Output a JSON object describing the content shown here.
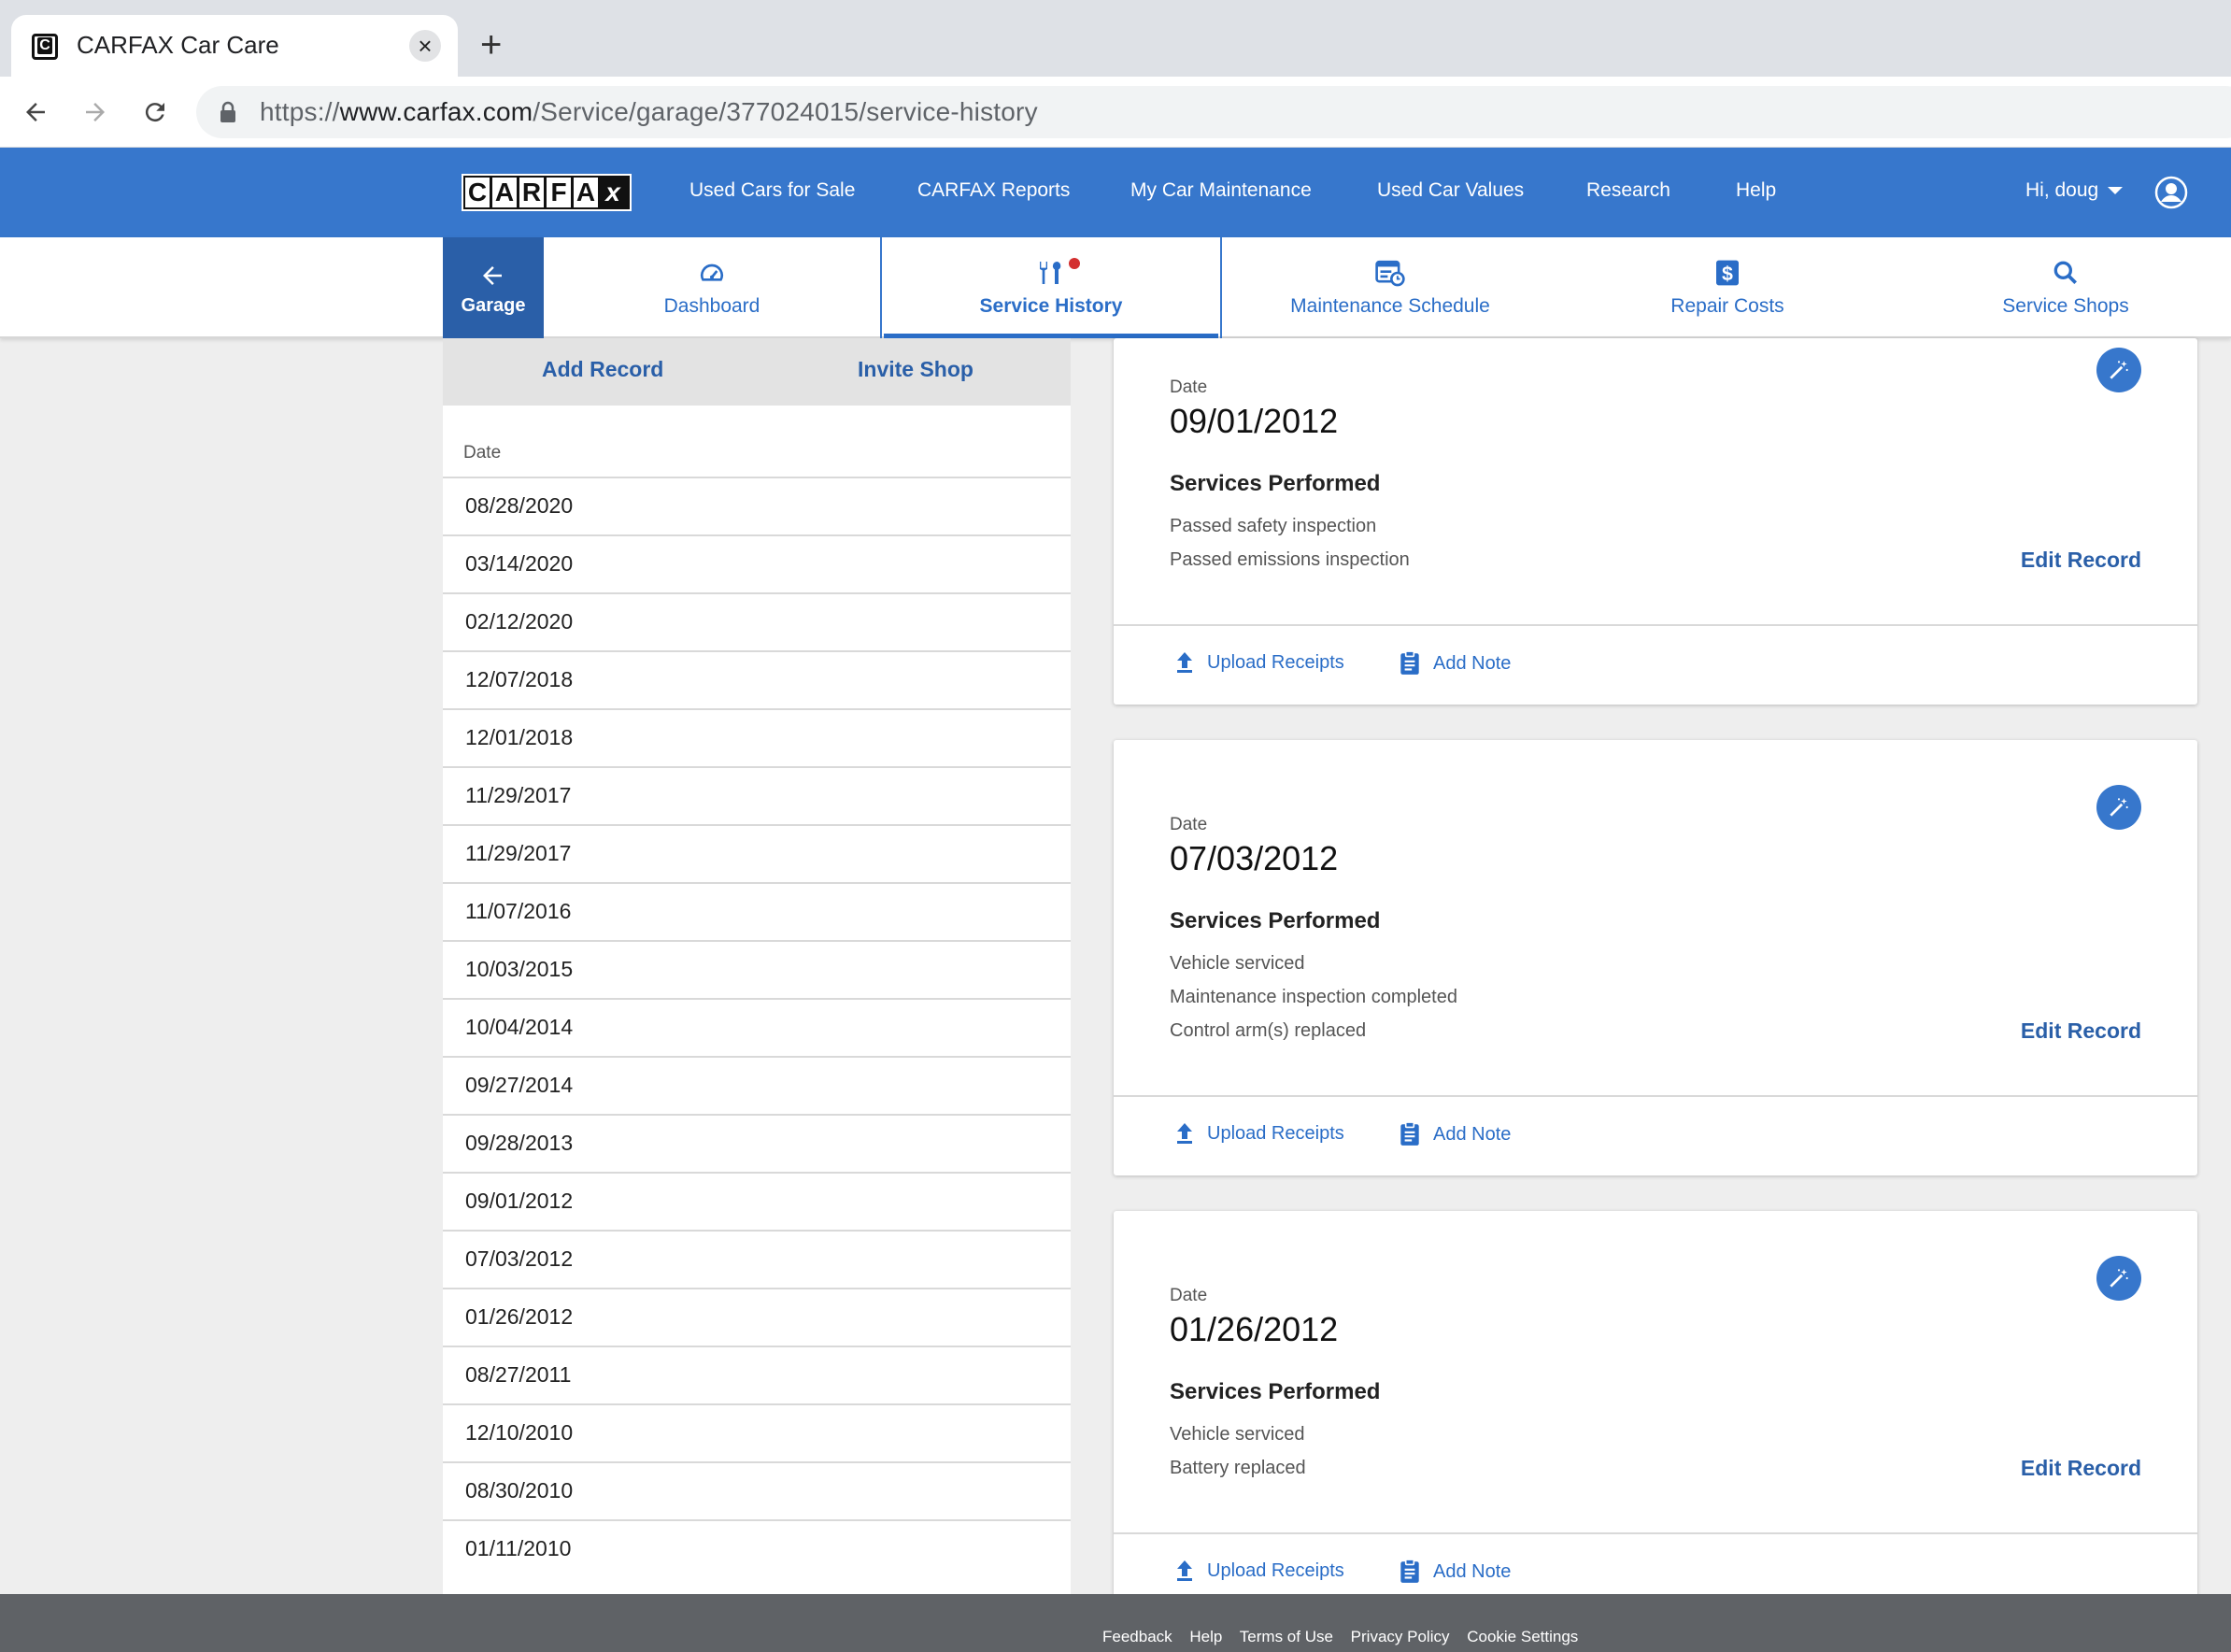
{
  "browser": {
    "tab_title": "CARFAX Car Care",
    "url_scheme": "https://",
    "url_host": "www.carfax.com",
    "url_path": "/Service/garage/377024015/service-history"
  },
  "header": {
    "logo_letters": [
      "C",
      "A",
      "R",
      "F",
      "A",
      "x"
    ],
    "nav": [
      "Used Cars for Sale",
      "CARFAX Reports",
      "My Car Maintenance",
      "Used Car Values",
      "Research",
      "Help"
    ],
    "greeting": "Hi, doug"
  },
  "subnav": {
    "garage": "Garage",
    "tabs": [
      "Dashboard",
      "Service History",
      "Maintenance Schedule",
      "Repair Costs",
      "Service Shops"
    ],
    "active_tab": "Service History"
  },
  "left": {
    "add_record": "Add Record",
    "invite_shop": "Invite Shop",
    "date_header": "Date",
    "dates": [
      "08/28/2020",
      "03/14/2020",
      "02/12/2020",
      "12/07/2018",
      "12/01/2018",
      "11/29/2017",
      "11/29/2017",
      "11/07/2016",
      "10/03/2015",
      "10/04/2014",
      "09/27/2014",
      "09/28/2013",
      "09/01/2012",
      "07/03/2012",
      "01/26/2012",
      "08/27/2011",
      "12/10/2010",
      "08/30/2010",
      "01/11/2010"
    ]
  },
  "records": [
    {
      "date_label": "Date",
      "date": "09/01/2012",
      "services_title": "Services Performed",
      "services": [
        "Passed safety inspection",
        "Passed emissions inspection"
      ],
      "edit": "Edit Record",
      "upload": "Upload Receipts",
      "note": "Add Note"
    },
    {
      "date_label": "Date",
      "date": "07/03/2012",
      "services_title": "Services Performed",
      "services": [
        "Vehicle serviced",
        "Maintenance inspection completed",
        "Control arm(s) replaced"
      ],
      "edit": "Edit Record",
      "upload": "Upload Receipts",
      "note": "Add Note"
    },
    {
      "date_label": "Date",
      "date": "01/26/2012",
      "services_title": "Services Performed",
      "services": [
        "Vehicle serviced",
        "Battery replaced"
      ],
      "edit": "Edit Record",
      "upload": "Upload Receipts",
      "note": "Add Note"
    }
  ],
  "footer": {
    "links": [
      "Feedback",
      "Help",
      "Terms of Use",
      "Privacy Policy",
      "Cookie Settings"
    ]
  },
  "colors": {
    "brand_blue": "#3777cc",
    "link_blue": "#2a6dc7",
    "footer_gray": "#5f6266"
  }
}
